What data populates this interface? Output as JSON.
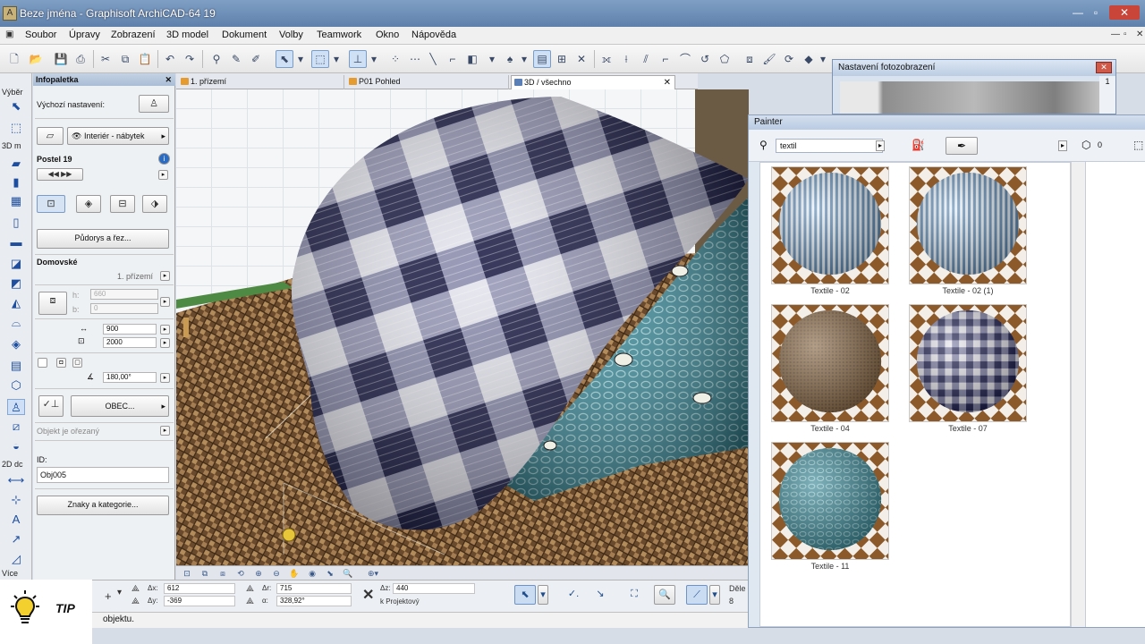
{
  "window": {
    "title": "Beze jména - Graphisoft ArchiCAD-64 19"
  },
  "menu": {
    "items": [
      "Soubor",
      "Úpravy",
      "Zobrazení",
      "3D model",
      "Dokument",
      "Volby",
      "Teamwork",
      "Okno",
      "Nápověda"
    ]
  },
  "toolbox": {
    "label_select": "Výběr",
    "label_3d": "3D m",
    "label_2d": "2D dc",
    "label_more": "Více"
  },
  "infobox": {
    "title": "Infopaletka",
    "default_settings": "Výchozí nastavení:",
    "layer_name": "Interiér - nábytek",
    "object_name": "Postel 19",
    "plan_section_button": "Půdorys a řez...",
    "home_story_label": "Domovské",
    "home_story_value": "1. přízemí",
    "field_a_label": "h:",
    "field_a_value": "660",
    "field_b_label": "b:",
    "field_b_value": "0",
    "width_value": "900",
    "length_value": "2000",
    "angle_value": "180,00°",
    "obec_button": "OBEC...",
    "not_cut_label": "Objekt je ořezaný",
    "id_label": "ID:",
    "id_value": "Obj005",
    "tags_button": "Znaky a kategorie..."
  },
  "tabs": [
    {
      "label": "1. přízemí",
      "active": false
    },
    {
      "label": "P01 Pohled",
      "active": false
    },
    {
      "label": "3D / všechno",
      "active": true
    }
  ],
  "coords": {
    "dx_label": "Δx:",
    "dx_value": "612",
    "dy_label": "Δy:",
    "dy_value": "-369",
    "a_label": "Δr:",
    "a_value": "715",
    "angle_label": "α:",
    "angle_value": "328,92°",
    "dz_label": "Δz:",
    "dz_value": "440",
    "ref_label": "k Projektový",
    "right_label": "Děle",
    "right_value": "8"
  },
  "status": {
    "text": "objektu."
  },
  "tip": {
    "label": "TIP"
  },
  "foto": {
    "title": "Nastavení fotozobrazení",
    "side_label": "1"
  },
  "painter": {
    "title": "Painter",
    "search": "textil",
    "count": "0",
    "materials": [
      {
        "name": "Textile - 02",
        "kind": "stripes"
      },
      {
        "name": "Textile - 02 (1)",
        "kind": "stripes"
      },
      {
        "name": "Textile - 04",
        "kind": "burlap"
      },
      {
        "name": "Textile - 07",
        "kind": "plaid"
      },
      {
        "name": "Textile - 11",
        "kind": "lace"
      }
    ]
  },
  "colors": {
    "accent": "#5e80ab",
    "plaid_dark": "#191a4b",
    "lace_teal": "#3e8a98",
    "burlap": "#7a5a36"
  }
}
